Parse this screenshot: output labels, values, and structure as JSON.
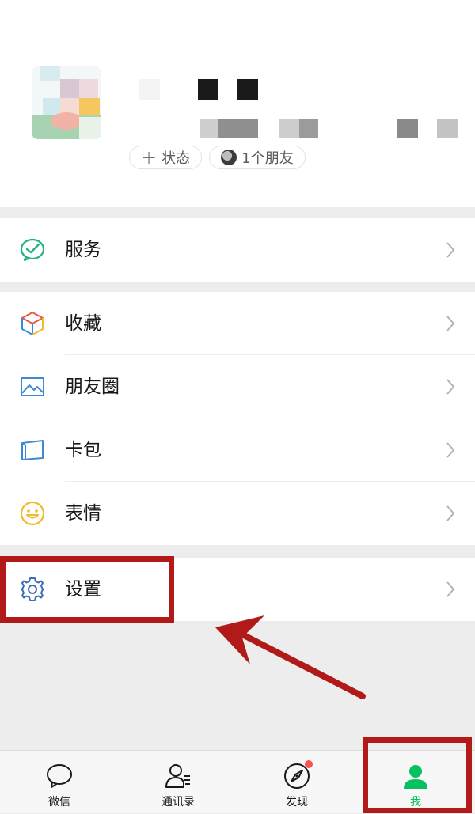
{
  "profile": {
    "status_label": "状态",
    "friends_label": "1个朋友"
  },
  "menu": {
    "services": "服务",
    "favorites": "收藏",
    "moments": "朋友圈",
    "cards": "卡包",
    "stickers": "表情",
    "settings": "设置"
  },
  "tabs": [
    {
      "label": "微信",
      "icon": "chat-bubble-icon"
    },
    {
      "label": "通讯录",
      "icon": "contacts-icon"
    },
    {
      "label": "发现",
      "icon": "compass-icon",
      "badge": true
    },
    {
      "label": "我",
      "icon": "person-icon",
      "active": true
    }
  ],
  "colors": {
    "accent": "#07c160",
    "annotation": "#b21a1a",
    "badge": "#fa5151"
  }
}
